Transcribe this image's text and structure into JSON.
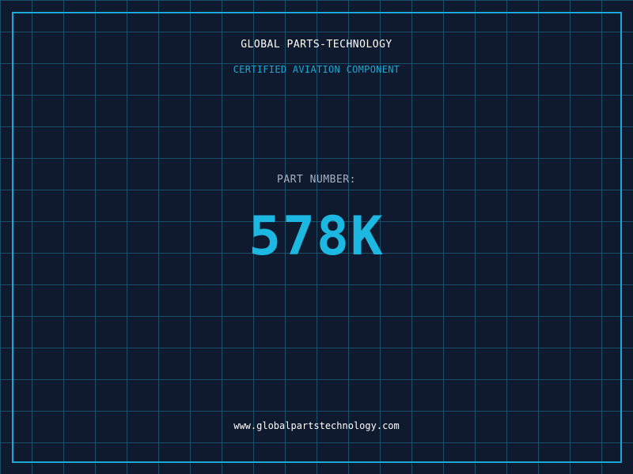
{
  "header": {
    "brand_name": "GLOBAL PARTS-TECHNOLOGY",
    "tagline": "CERTIFIED AVIATION COMPONENT"
  },
  "part": {
    "label": "PART NUMBER:",
    "number": "578K"
  },
  "footer": {
    "website": "www.globalpartstechnology.com"
  },
  "colors": {
    "background": "#0f1a2e",
    "grid": "#287896",
    "accent": "#1cb8e2",
    "frame": "#1aa8d4",
    "label": "#a6b1c2",
    "text": "#ffffff"
  }
}
